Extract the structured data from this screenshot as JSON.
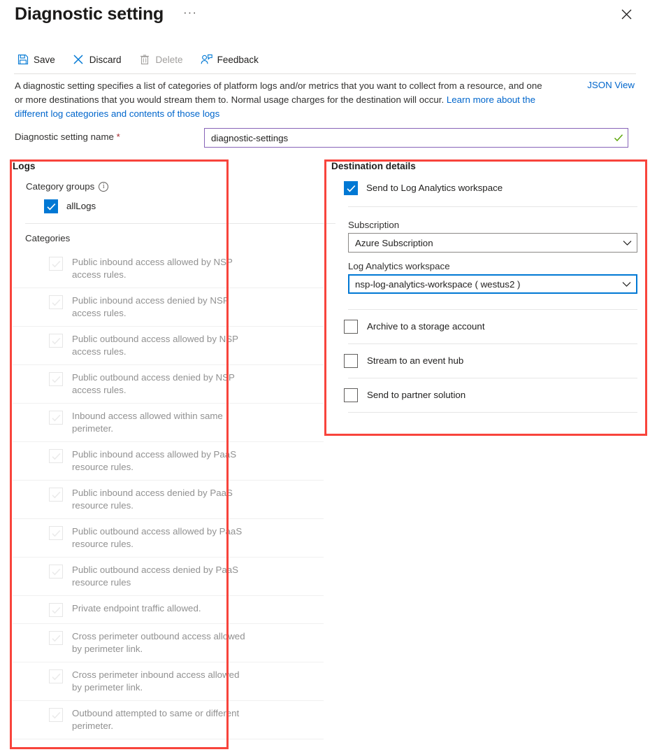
{
  "header": {
    "title": "Diagnostic setting",
    "ellipsis": "···",
    "close_icon": "close-icon"
  },
  "toolbar": {
    "items": [
      {
        "label": "Save",
        "icon": "save-icon",
        "disabled": false
      },
      {
        "label": "Discard",
        "icon": "discard-x-icon",
        "disabled": false
      },
      {
        "label": "Delete",
        "icon": "trash-icon",
        "disabled": true
      },
      {
        "label": "Feedback",
        "icon": "feedback-person-icon",
        "disabled": false
      }
    ]
  },
  "description": {
    "part1": "A diagnostic setting specifies a list of categories of platform logs and/or metrics that you want to collect from a resource, and one or more destinations that you would stream them to. Normal usage charges for the destination will occur. ",
    "link": "Learn more about the different log categories and contents of those logs",
    "json_view_label": "JSON View"
  },
  "name_field": {
    "label": "Diagnostic setting name",
    "required_marker": "*",
    "value": "diagnostic-settings",
    "placeholder": "Diagnostic setting name",
    "valid_icon": "green-check-icon",
    "border_color": "#8764b8"
  },
  "logs": {
    "title": "Logs",
    "category_groups_label": "Category groups",
    "info_icon": "info-icon",
    "all_logs": {
      "label": "allLogs",
      "checked": true
    },
    "categories_label": "Categories",
    "categories": [
      {
        "label": "Public inbound access allowed by NSP access rules.",
        "checked": true,
        "disabled": true
      },
      {
        "label": "Public inbound access denied by NSP access rules.",
        "checked": true,
        "disabled": true
      },
      {
        "label": "Public outbound access allowed by NSP access rules.",
        "checked": true,
        "disabled": true
      },
      {
        "label": "Public outbound access denied by NSP access rules.",
        "checked": true,
        "disabled": true
      },
      {
        "label": "Inbound access allowed within same perimeter.",
        "checked": true,
        "disabled": true
      },
      {
        "label": "Public inbound access allowed by PaaS resource rules.",
        "checked": true,
        "disabled": true
      },
      {
        "label": "Public inbound access denied by PaaS resource rules.",
        "checked": true,
        "disabled": true
      },
      {
        "label": "Public outbound access allowed by PaaS resource rules.",
        "checked": true,
        "disabled": true
      },
      {
        "label": "Public outbound access denied by PaaS resource rules",
        "checked": true,
        "disabled": true
      },
      {
        "label": "Private endpoint traffic allowed.",
        "checked": true,
        "disabled": true
      },
      {
        "label": "Cross perimeter outbound access allowed by perimeter link.",
        "checked": true,
        "disabled": true
      },
      {
        "label": "Cross perimeter inbound access allowed by perimeter link.",
        "checked": true,
        "disabled": true
      },
      {
        "label": "Outbound attempted to same or different perimeter.",
        "checked": true,
        "disabled": true
      }
    ]
  },
  "destination": {
    "title": "Destination details",
    "send_log_analytics": {
      "label": "Send to Log Analytics workspace",
      "checked": true
    },
    "subscription": {
      "label": "Subscription",
      "value": "Azure Subscription",
      "focused": false
    },
    "workspace": {
      "label": "Log Analytics workspace",
      "value": "nsp-log-analytics-workspace ( westus2 )",
      "focused": true
    },
    "options": [
      {
        "label": "Archive to a storage account",
        "checked": false
      },
      {
        "label": "Stream to an event hub",
        "checked": false
      },
      {
        "label": "Send to partner solution",
        "checked": false
      }
    ]
  },
  "annotations": {
    "highlight_color": "#f8443c",
    "boxes": [
      "logs-highlight-box",
      "destination-highlight-box"
    ]
  },
  "colors": {
    "accent": "#0078d4",
    "link": "#0066cc",
    "required": "#a4262c",
    "valid": "#57a300",
    "name_border": "#8764b8",
    "highlight": "#f8443c"
  }
}
